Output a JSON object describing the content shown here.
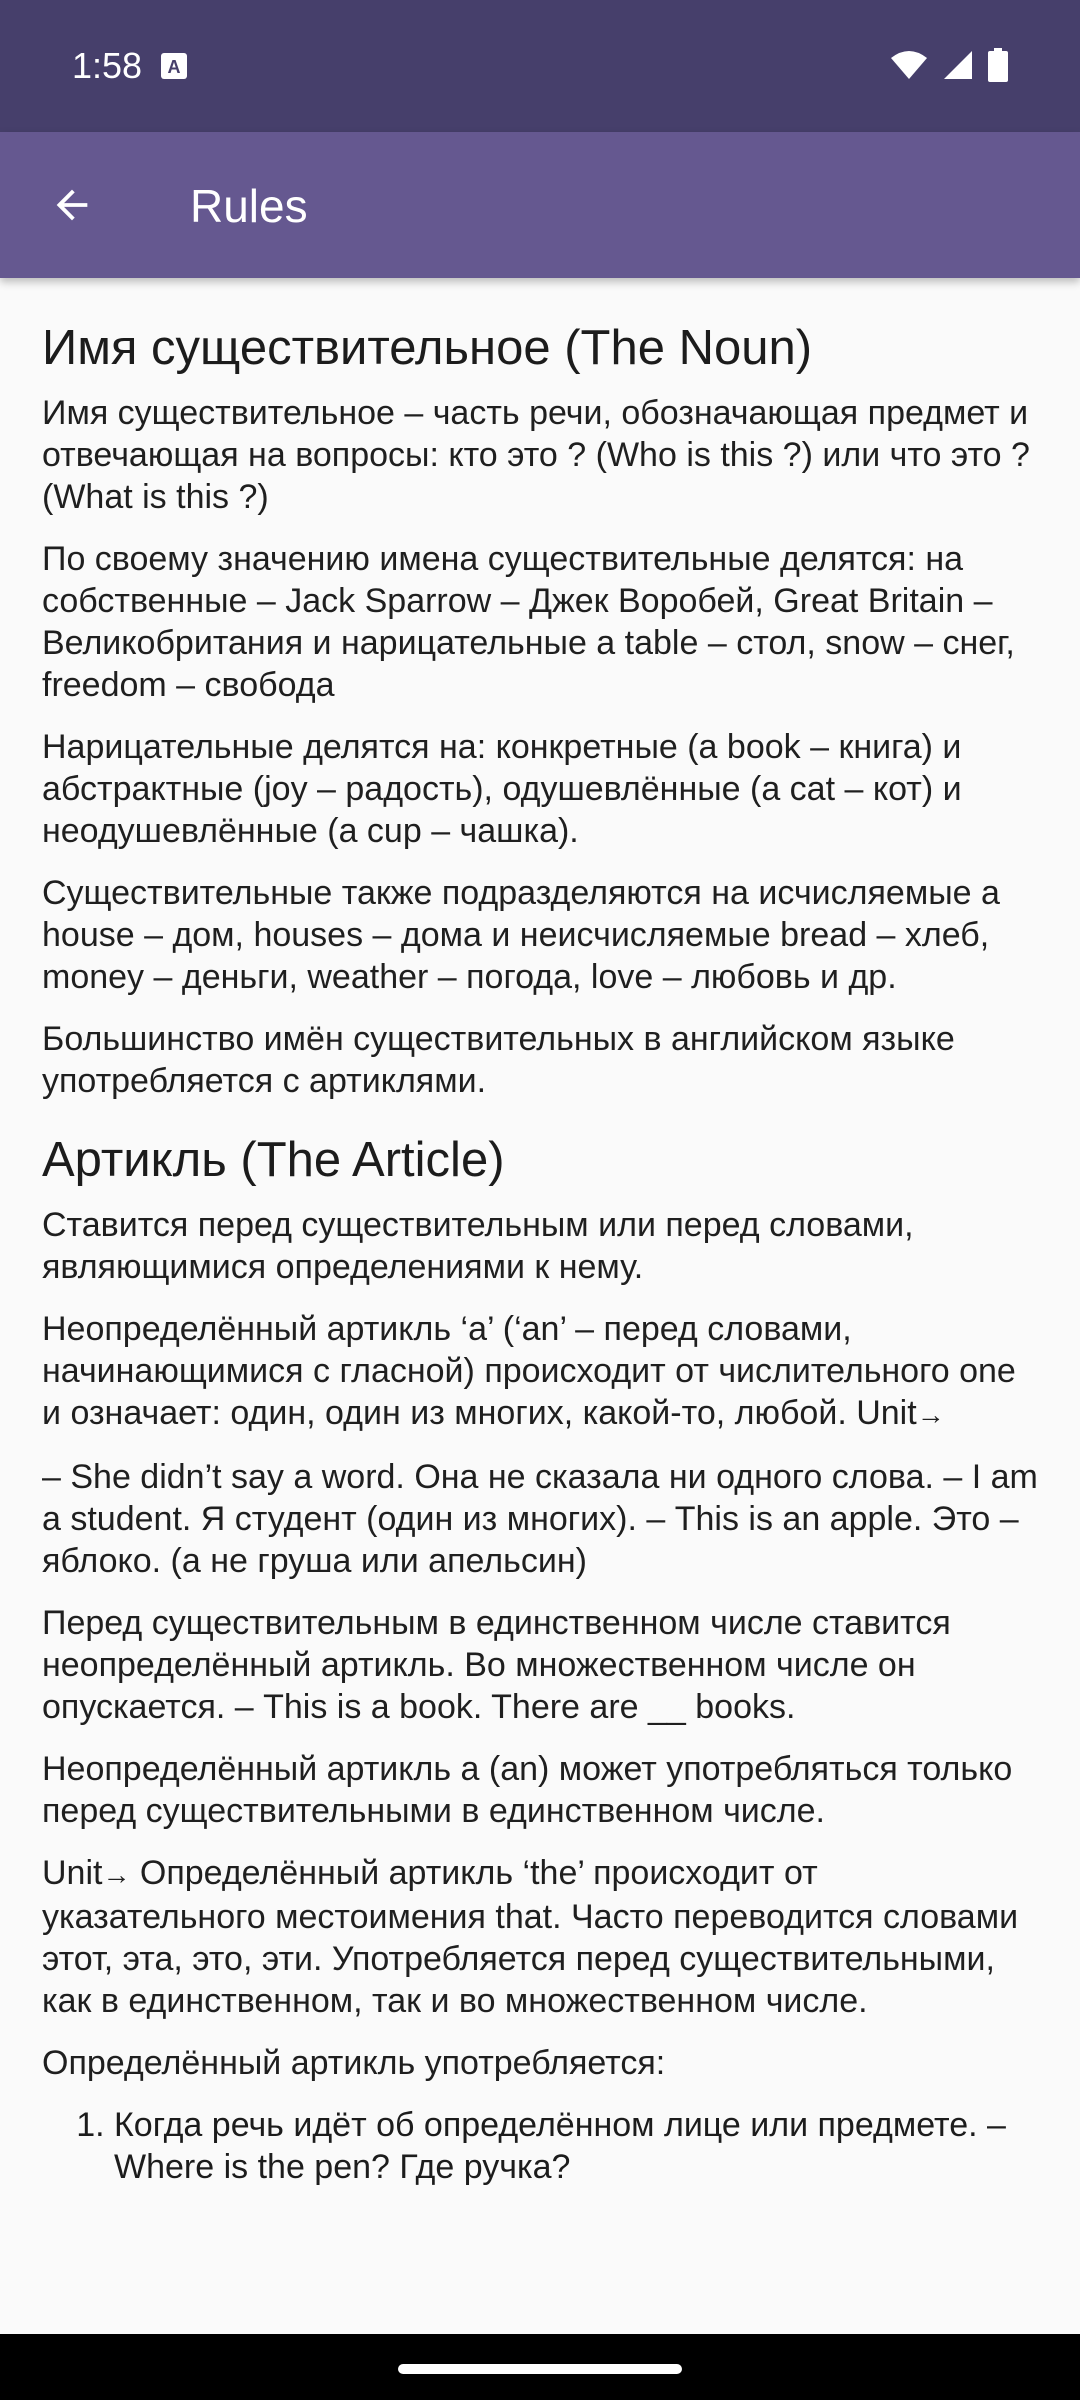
{
  "status": {
    "time": "1:58"
  },
  "app_bar": {
    "title": "Rules"
  },
  "content": {
    "noun_heading": "Имя существительное (The Noun)",
    "noun_p1": "Имя существительное – часть речи, обозначающая предмет и отвечающая на вопросы: кто это ? (Who is this ?) или что это ? (What is this ?)",
    "noun_p2": "По своему значению имена существительные делятся: на собственные – Jack Sparrow – Джек Воробей, Great Britain – Великобритания и нарицательные a table – стол, snow – снег,  freedom – свобода",
    "noun_p3": "Нарицательные делятся на: конкретные (a book – книга) и абстрактные (joy – радость), одушевлённые (a cat – кот) и неодушевлённые (a cup – чашка).",
    "noun_p4": "Существительные также подразделяются на исчисляемые a house – дом, houses – дома и неисчисляемые bread – хлеб,  money – деньги,  weather – погода,  love – любовь и др.",
    "noun_p5": "Большинство имён существительных в английском языке употребляется с артиклями.",
    "article_heading": "Артикль (The Article)",
    "article_p1": "Ставится перед существительным или перед словами, являющимися определениями к нему.",
    "article_p2": "Неопределённый артикль ‘a’ (‘an’ – перед словами, начинающимися с гласной) происходит от числительного one и означает: один, один из многих, какой-то, любой. Unit",
    "arrow": "→",
    "article_p3": "– She didn’t say a word. Она не сказала ни одного слова. – I am a student. Я студент (один из многих). – This is an apple. Это – яблоко. (а не груша или апельсин)",
    "article_p4": "Перед существительным в единственном числе ставится неопределённый артикль. Во множественном числе он опускается. – This is a book. There are __ books.",
    "article_p5": "Неопределённый артикль a (an) может употребляться только перед существительными в единственном числе.",
    "article_p6_unit": "Unit",
    "article_p6": "  Определённый артикль ‘the’ происходит от указательного местоимения that. Часто переводится словами этот, эта, это, эти. Употребляется перед существительными, как в единственном, так и во множественном числе.",
    "article_p7": "Определённый артикль употребляется:",
    "list_items": [
      "Когда речь идёт об определённом лице или предмете. – Where is the pen?  Где ручка?"
    ]
  }
}
